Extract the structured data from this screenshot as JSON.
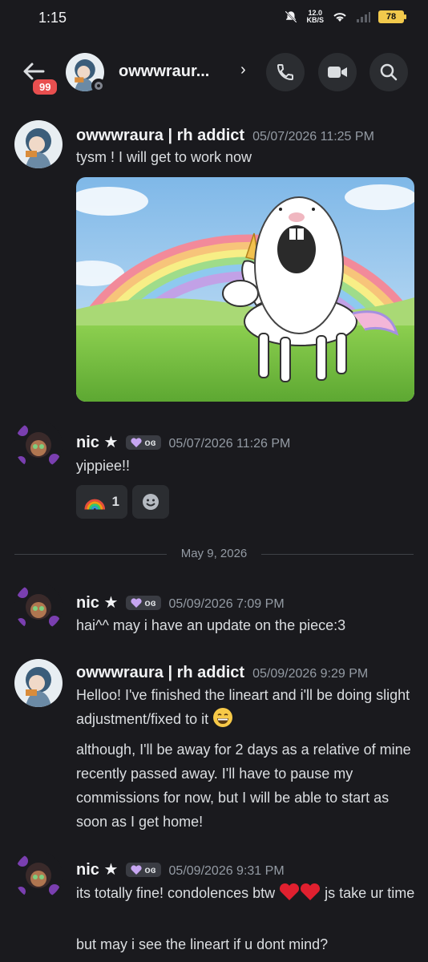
{
  "status_bar": {
    "time": "1:15",
    "speed_value": "12.0",
    "speed_unit": "KB/S",
    "battery": "78"
  },
  "header": {
    "unread_badge": "99",
    "title": "owwwraur...",
    "chevron": "›"
  },
  "messages": [
    {
      "author": "owwwraura | rh addict",
      "timestamp": "05/07/2026 11:25 PM",
      "lines": [
        "tysm ! I will get to work now"
      ]
    },
    {
      "author": "nic ★",
      "guild_tag": "ᴏɞ",
      "timestamp": "05/07/2026 11:26 PM",
      "lines": [
        "yippiee!!"
      ],
      "reaction_emoji": "rainbow-emoji",
      "reaction_count": "1"
    },
    {
      "author": "nic ★",
      "guild_tag": "ᴏɞ",
      "timestamp": "05/09/2026 7:09 PM",
      "lines": [
        "hai^^ may i have an update on the piece:3"
      ]
    },
    {
      "author": "owwwraura | rh addict",
      "timestamp": "05/09/2026 9:29 PM",
      "lines": [
        "Helloo! I've finished the lineart and i'll be doing slight adjustment/fixed to it",
        "although, I'll be away for 2 days as a relative of mine recently passed away. I'll have to pause my commissions for now, but I will be able to start as soon as I get home!"
      ]
    },
    {
      "author": "nic ★",
      "guild_tag": "ᴏɞ",
      "timestamp": "05/09/2026 9:31 PM",
      "lines": [
        "its totally fine! condolences btw",
        "js take ur time",
        "but may i see the lineart if u dont mind?"
      ]
    }
  ],
  "date_divider": "May 9, 2026",
  "colors": {
    "background": "#1a1a1e",
    "badge_red": "#e84f4f",
    "text": "#dbdee1",
    "muted": "#949ba4"
  }
}
